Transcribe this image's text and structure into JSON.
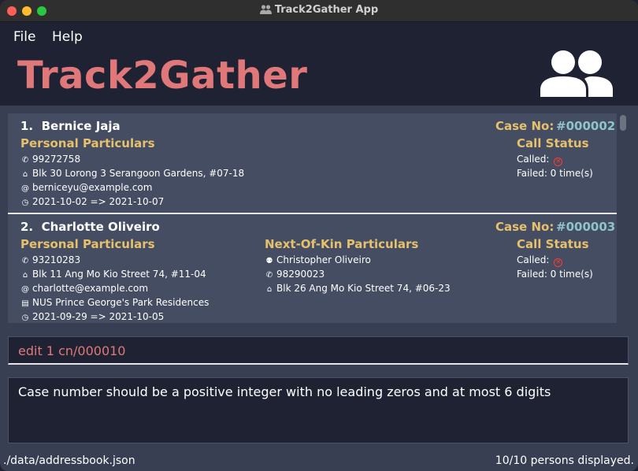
{
  "window": {
    "title": "Track2Gather App"
  },
  "menu": {
    "file": "File",
    "help": "Help"
  },
  "header": {
    "title": "Track2Gather"
  },
  "persons": [
    {
      "index": "1.",
      "name": "Bernice Jaja",
      "case_label": "Case No:",
      "case_number": "#000002",
      "personal_title": "Personal Particulars",
      "phone": "99272758",
      "address": "Blk 30 Lorong 3 Serangoon Gardens, #07-18",
      "email": "berniceyu@example.com",
      "period": "2021-10-02 => 2021-10-07",
      "call_title": "Call Status",
      "called": "Called:",
      "failed": "Failed: 0 time(s)"
    },
    {
      "index": "2.",
      "name": "Charlotte Oliveiro",
      "case_label": "Case No:",
      "case_number": "#000003",
      "personal_title": "Personal Particulars",
      "phone": "93210283",
      "address": "Blk 11 Ang Mo Kio Street 74, #11-04",
      "email": "charlotte@example.com",
      "shn": "NUS Prince George's Park Residences",
      "period": "2021-09-29 => 2021-10-05",
      "nok_title": "Next-Of-Kin Particulars",
      "nok_name": "Christopher Oliveiro",
      "nok_phone": "98290023",
      "nok_address": "Blk 26 Ang Mo Kio Street 74, #06-23",
      "call_title": "Call Status",
      "called": "Called:",
      "failed": "Failed: 0 time(s)"
    }
  ],
  "command": {
    "value": "edit 1 cn/000010"
  },
  "result": {
    "message": "Case number should be a positive integer with no leading zeros and at most 6 digits"
  },
  "status": {
    "file_path": "./data/addressbook.json",
    "count": "10/10 persons displayed."
  },
  "colors": {
    "accent": "#e0787a",
    "section": "#e6c06a",
    "case_number": "#8ec5c6",
    "background": "#1e2233",
    "panel": "#383f53",
    "card": "#454d63"
  },
  "icons": [
    "phone-icon",
    "home-icon",
    "email-icon",
    "clock-icon",
    "bed-icon",
    "people-icon",
    "cross-icon"
  ]
}
